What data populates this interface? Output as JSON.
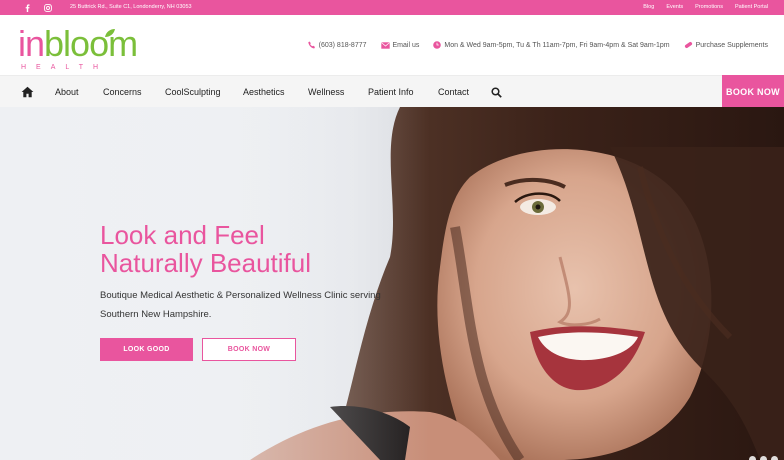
{
  "topbar": {
    "address": "25 Buttrick Rd., Suite C1, Londonderry, NH 03053",
    "links": [
      "Blog",
      "Events",
      "Promotions",
      "Patient Portal"
    ],
    "social_icons": [
      "facebook-icon",
      "instagram-icon"
    ]
  },
  "logo": {
    "part1": "in",
    "part2": "bloom",
    "tagline": "HEALTH"
  },
  "contact": {
    "phone": "(603) 818-8777",
    "email": "Email us",
    "hours": "Mon & Wed 9am-5pm, Tu & Th 11am-7pm, Fri 9am-4pm & Sat 9am-1pm",
    "supplements": "Purchase Supplements"
  },
  "nav": {
    "items": [
      "About",
      "Concerns",
      "CoolSculpting",
      "Aesthetics",
      "Wellness",
      "Patient Info",
      "Contact"
    ],
    "book_label": "BOOK NOW"
  },
  "hero": {
    "headline_line1": "Look and Feel",
    "headline_line2": "Naturally Beautiful",
    "subtitle": "Boutique Medical Aesthetic & Personalized Wellness Clinic serving Southern New Hampshire.",
    "button_primary": "LOOK GOOD",
    "button_secondary": "BOOK NOW"
  },
  "colors": {
    "brand_pink": "#e9559e",
    "brand_green": "#7bbf3a"
  }
}
